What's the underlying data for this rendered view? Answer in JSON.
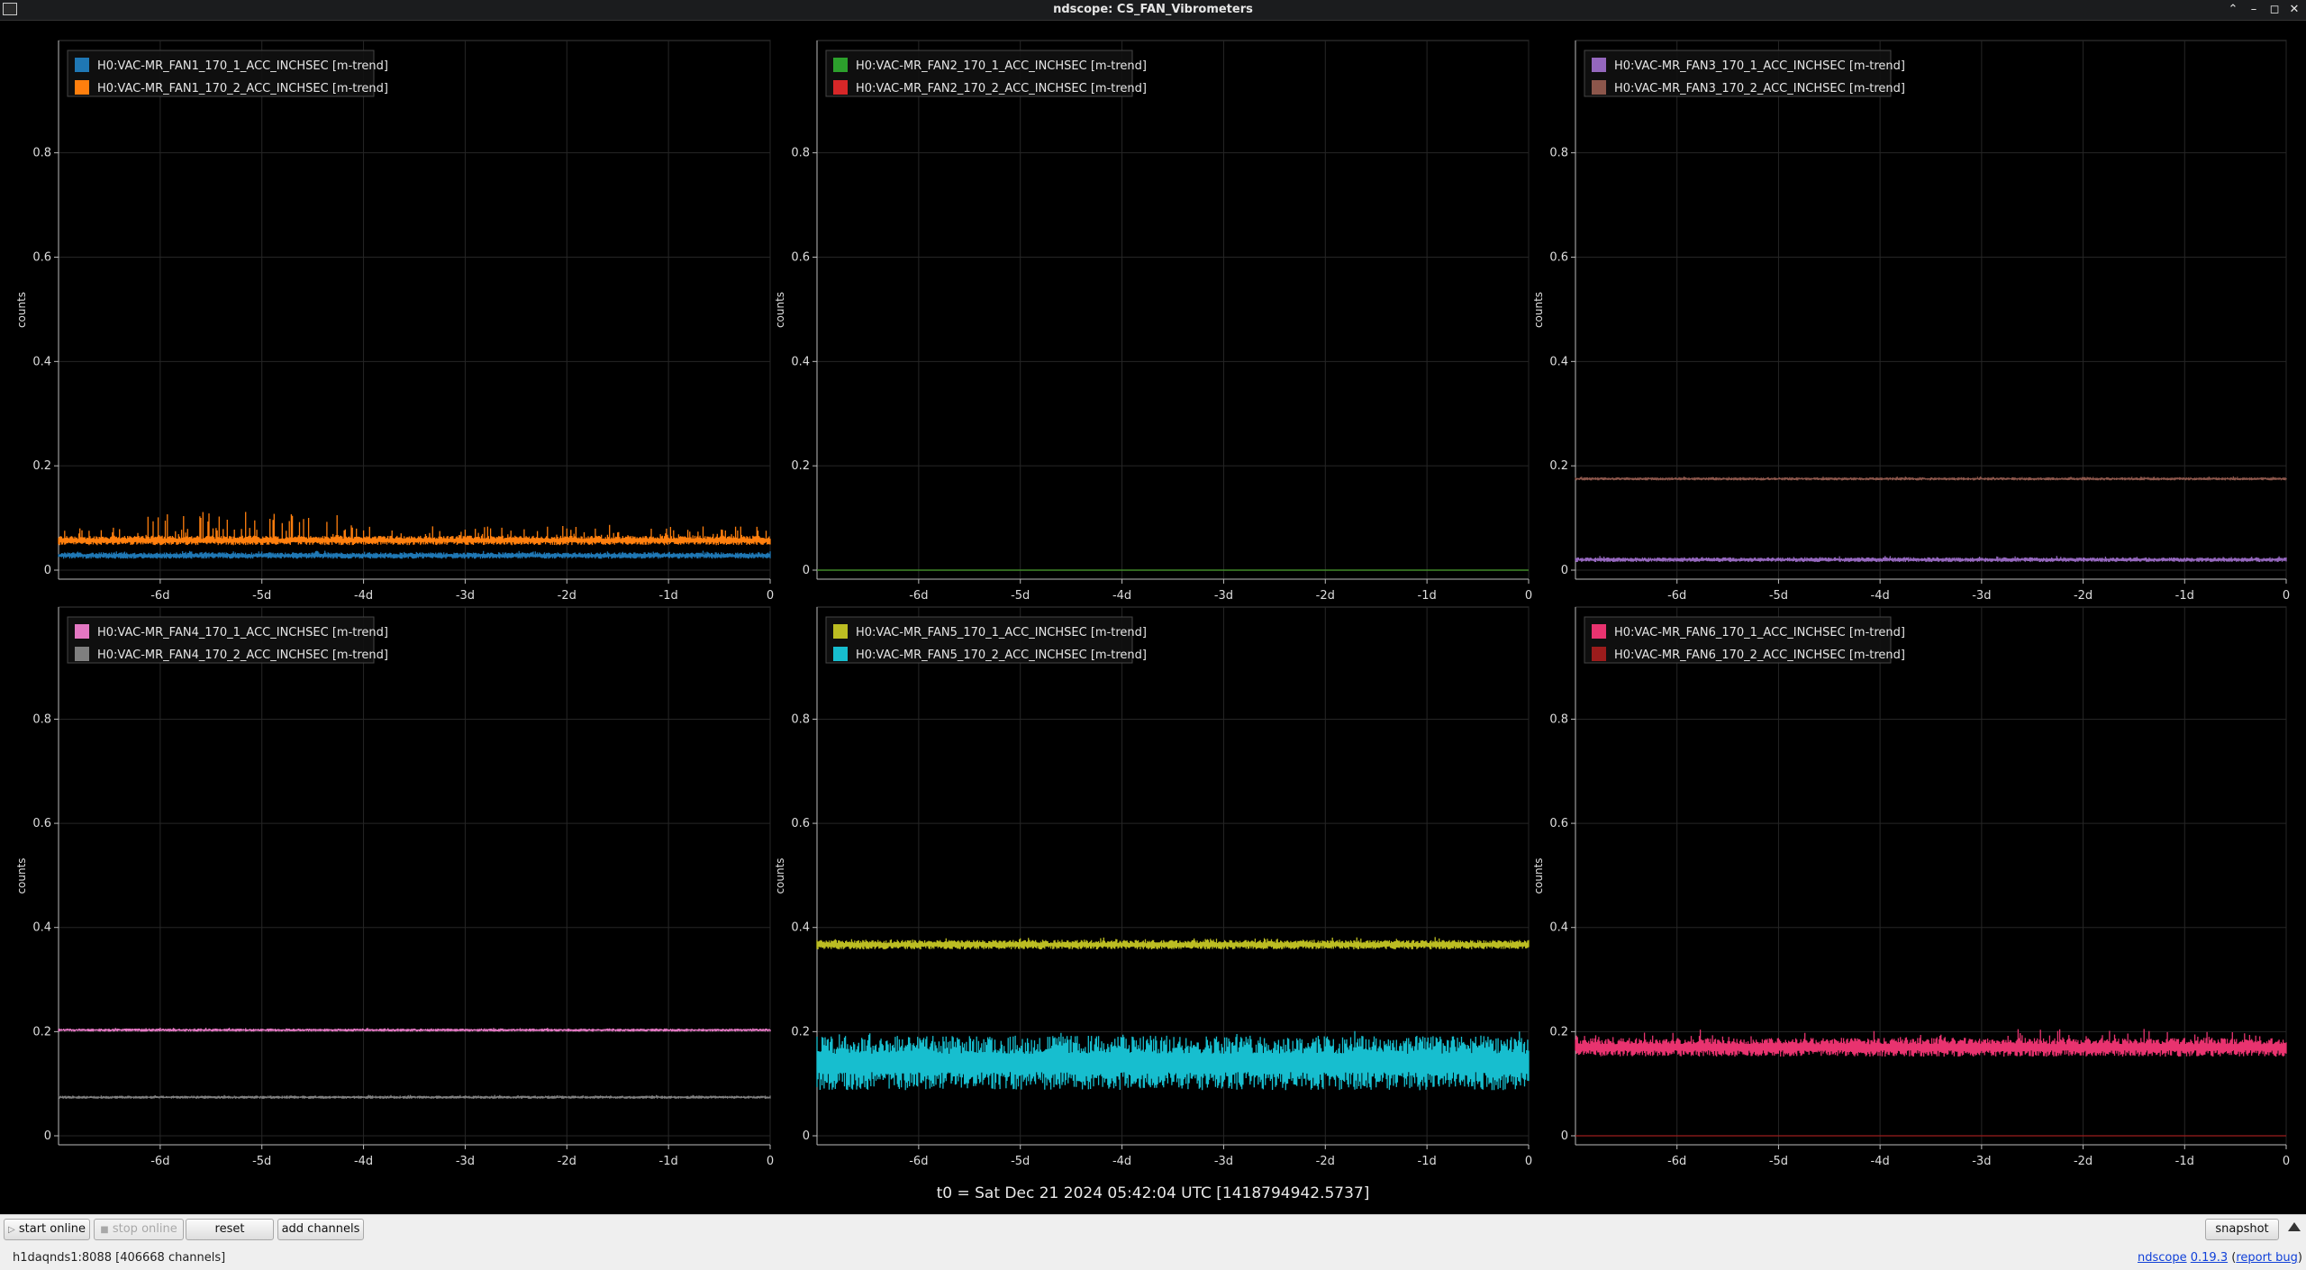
{
  "window": {
    "title": "ndscope: CS_FAN_Vibrometers",
    "minimize_glyph": "⌃",
    "min_glyph": "–",
    "max_glyph": "◻",
    "close_glyph": "✕"
  },
  "toolbar": {
    "start_online": "start online",
    "stop_online": "stop online",
    "reset": "reset",
    "add_channels": "add channels",
    "snapshot": "snapshot"
  },
  "status": {
    "server": "h1daqnds1:8088",
    "channels": "[406668 channels]",
    "app_name": "ndscope",
    "version": "0.19.3",
    "report_bug": "report bug"
  },
  "t0_label": "t0 = Sat Dec 21 2024 05:42:04 UTC [1418794942.5737]",
  "chart_data": [
    {
      "type": "line",
      "ylabel": "counts",
      "ylim": [
        0,
        1
      ],
      "xlim": [
        -7,
        0
      ],
      "xticks": [
        -6,
        -5,
        -4,
        -3,
        -2,
        -1,
        0
      ],
      "xtick_labels": [
        "-6d",
        "-5d",
        "-4d",
        "-3d",
        "-2d",
        "-1d",
        "0"
      ],
      "yticks": [
        0,
        0.2,
        0.4,
        0.6,
        0.8
      ],
      "ytick_labels": [
        "0",
        "0.2",
        "0.4",
        "0.6",
        "0.8"
      ],
      "grid": true,
      "legend": "top-left",
      "series": [
        {
          "name": "H0:VAC-MR_FAN1_170_1_ACC_INCHSEC [m-trend]",
          "color": "#1f77b4",
          "level": 0.028,
          "noise": 0.004,
          "spikes": 0.004
        },
        {
          "name": "H0:VAC-MR_FAN1_170_2_ACC_INCHSEC [m-trend]",
          "color": "#ff7f0e",
          "level": 0.057,
          "noise": 0.006,
          "spikes": 0.04
        }
      ]
    },
    {
      "type": "line",
      "ylabel": "counts",
      "ylim": [
        0,
        1
      ],
      "xlim": [
        -7,
        0
      ],
      "xticks": [
        -6,
        -5,
        -4,
        -3,
        -2,
        -1,
        0
      ],
      "xtick_labels": [
        "-6d",
        "-5d",
        "-4d",
        "-3d",
        "-2d",
        "-1d",
        "0"
      ],
      "yticks": [
        0,
        0.2,
        0.4,
        0.6,
        0.8
      ],
      "ytick_labels": [
        "0",
        "0.2",
        "0.4",
        "0.6",
        "0.8"
      ],
      "grid": true,
      "legend": "top-left",
      "series": [
        {
          "name": "H0:VAC-MR_FAN2_170_1_ACC_INCHSEC [m-trend]",
          "color": "#2ca02c",
          "level": 0.0,
          "noise": 0.0,
          "spikes": 0.0
        },
        {
          "name": "H0:VAC-MR_FAN2_170_2_ACC_INCHSEC [m-trend]",
          "color": "#d62728",
          "level": 0.0,
          "noise": 0.0,
          "spikes": 0.0
        }
      ]
    },
    {
      "type": "line",
      "ylabel": "counts",
      "ylim": [
        0,
        1
      ],
      "xlim": [
        -7,
        0
      ],
      "xticks": [
        -6,
        -5,
        -4,
        -3,
        -2,
        -1,
        0
      ],
      "xtick_labels": [
        "-6d",
        "-5d",
        "-4d",
        "-3d",
        "-2d",
        "-1d",
        "0"
      ],
      "yticks": [
        0,
        0.2,
        0.4,
        0.6,
        0.8
      ],
      "ytick_labels": [
        "0",
        "0.2",
        "0.4",
        "0.6",
        "0.8"
      ],
      "grid": true,
      "legend": "top-left",
      "series": [
        {
          "name": "H0:VAC-MR_FAN3_170_1_ACC_INCHSEC [m-trend]",
          "color": "#9467bd",
          "level": 0.02,
          "noise": 0.003,
          "spikes": 0.003
        },
        {
          "name": "H0:VAC-MR_FAN3_170_2_ACC_INCHSEC [m-trend]",
          "color": "#8c564b",
          "level": 0.175,
          "noise": 0.002,
          "spikes": 0.002
        }
      ]
    },
    {
      "type": "line",
      "ylabel": "counts",
      "ylim": [
        0,
        1
      ],
      "xlim": [
        -7,
        0
      ],
      "xticks": [
        -6,
        -5,
        -4,
        -3,
        -2,
        -1,
        0
      ],
      "xtick_labels": [
        "-6d",
        "-5d",
        "-4d",
        "-3d",
        "-2d",
        "-1d",
        "0"
      ],
      "yticks": [
        0,
        0.2,
        0.4,
        0.6,
        0.8
      ],
      "ytick_labels": [
        "0",
        "0.2",
        "0.4",
        "0.6",
        "0.8"
      ],
      "grid": true,
      "legend": "top-left",
      "series": [
        {
          "name": "H0:VAC-MR_FAN4_170_1_ACC_INCHSEC [m-trend]",
          "color": "#e377c2",
          "level": 0.203,
          "noise": 0.002,
          "spikes": 0.002
        },
        {
          "name": "H0:VAC-MR_FAN4_170_2_ACC_INCHSEC [m-trend]",
          "color": "#7f7f7f",
          "level": 0.074,
          "noise": 0.002,
          "spikes": 0.002
        }
      ]
    },
    {
      "type": "line",
      "ylabel": "counts",
      "ylim": [
        0,
        1
      ],
      "xlim": [
        -7,
        0
      ],
      "xticks": [
        -6,
        -5,
        -4,
        -3,
        -2,
        -1,
        0
      ],
      "xtick_labels": [
        "-6d",
        "-5d",
        "-4d",
        "-3d",
        "-2d",
        "-1d",
        "0"
      ],
      "yticks": [
        0,
        0.2,
        0.4,
        0.6,
        0.8
      ],
      "ytick_labels": [
        "0",
        "0.2",
        "0.4",
        "0.6",
        "0.8"
      ],
      "grid": true,
      "legend": "top-left",
      "series": [
        {
          "name": "H0:VAC-MR_FAN5_170_1_ACC_INCHSEC [m-trend]",
          "color": "#bcbd22",
          "level": 0.367,
          "noise": 0.006,
          "spikes": 0.006
        },
        {
          "name": "H0:VAC-MR_FAN5_170_2_ACC_INCHSEC [m-trend]",
          "color": "#17becf",
          "level": 0.14,
          "noise": 0.035,
          "spikes": 0.01
        }
      ]
    },
    {
      "type": "line",
      "ylabel": "counts",
      "ylim": [
        0,
        1
      ],
      "xlim": [
        -7,
        0
      ],
      "xticks": [
        -6,
        -5,
        -4,
        -3,
        -2,
        -1,
        0
      ],
      "xtick_labels": [
        "-6d",
        "-5d",
        "-4d",
        "-3d",
        "-2d",
        "-1d",
        "0"
      ],
      "yticks": [
        0,
        0.2,
        0.4,
        0.6,
        0.8
      ],
      "ytick_labels": [
        "0",
        "0.2",
        "0.4",
        "0.6",
        "0.8"
      ],
      "grid": true,
      "legend": "top-left",
      "series": [
        {
          "name": "H0:VAC-MR_FAN6_170_1_ACC_INCHSEC [m-trend]",
          "color": "#e8336f",
          "level": 0.17,
          "noise": 0.012,
          "spikes": 0.02
        },
        {
          "name": "H0:VAC-MR_FAN6_170_2_ACC_INCHSEC [m-trend]",
          "color": "#9b1c1c",
          "level": 0.0,
          "noise": 0.0,
          "spikes": 0.0
        }
      ]
    }
  ]
}
